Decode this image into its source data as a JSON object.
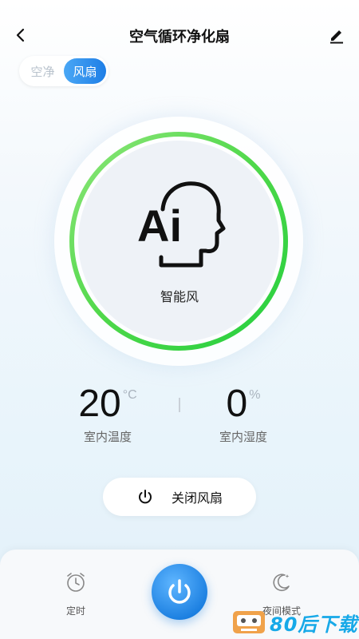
{
  "header": {
    "title": "空气循环净化扇",
    "back_icon": "chevron-left-icon",
    "edit_icon": "pencil-icon"
  },
  "mode_switch": {
    "options": [
      {
        "label": "空净",
        "active": false
      },
      {
        "label": "风扇",
        "active": true
      }
    ]
  },
  "dial": {
    "icon": "ai-head-icon",
    "mode_label": "智能风",
    "ring_color": "#34d24a"
  },
  "stats": {
    "temperature": {
      "value": "20",
      "unit": "°C",
      "label": "室内温度"
    },
    "humidity": {
      "value": "0",
      "unit": "%",
      "label": "室内湿度"
    }
  },
  "power_pill": {
    "icon": "power-icon",
    "label": "关闭风扇"
  },
  "bottom_bar": {
    "timer": {
      "icon": "alarm-clock-icon",
      "label": "定时"
    },
    "power": {
      "icon": "power-icon",
      "color": "#1a7ee0"
    },
    "night": {
      "icon": "moon-stars-icon",
      "label": "夜间模式"
    }
  },
  "watermark": {
    "text": "80后下载",
    "color": "#17a9e8"
  },
  "colors": {
    "accent": "#1e7ee6",
    "ring_green": "#34d24a"
  }
}
